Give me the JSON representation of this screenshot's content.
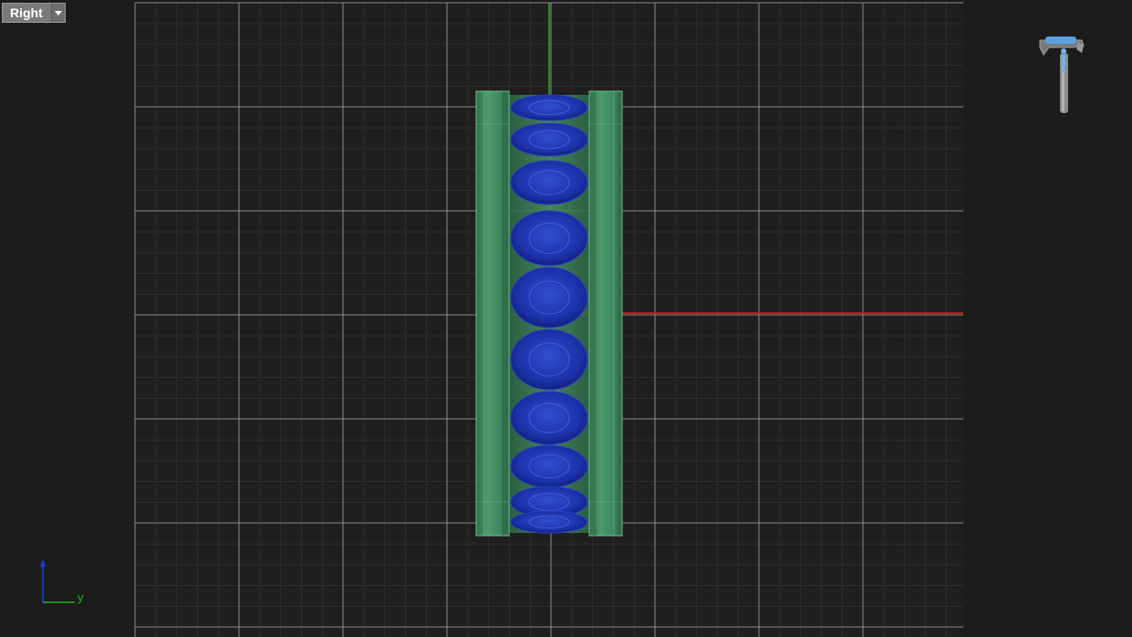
{
  "viewport": {
    "view_name": "Right",
    "view_menu_icon": "chevron-down-icon",
    "axis_indicator": {
      "y_label": "y"
    },
    "navigation_icon": "ring-model-thumbnail-icon",
    "colors": {
      "background": "#1c1c1c",
      "grid_background": "#1f1f1f",
      "grid_major": "#8a8a8a",
      "grid_minor": "#3c3c3c",
      "x_axis": "#e01b1b",
      "y_axis": "#1db41d",
      "band_metal": "#3f8a5e",
      "gemstone": "#1a2faa"
    }
  }
}
